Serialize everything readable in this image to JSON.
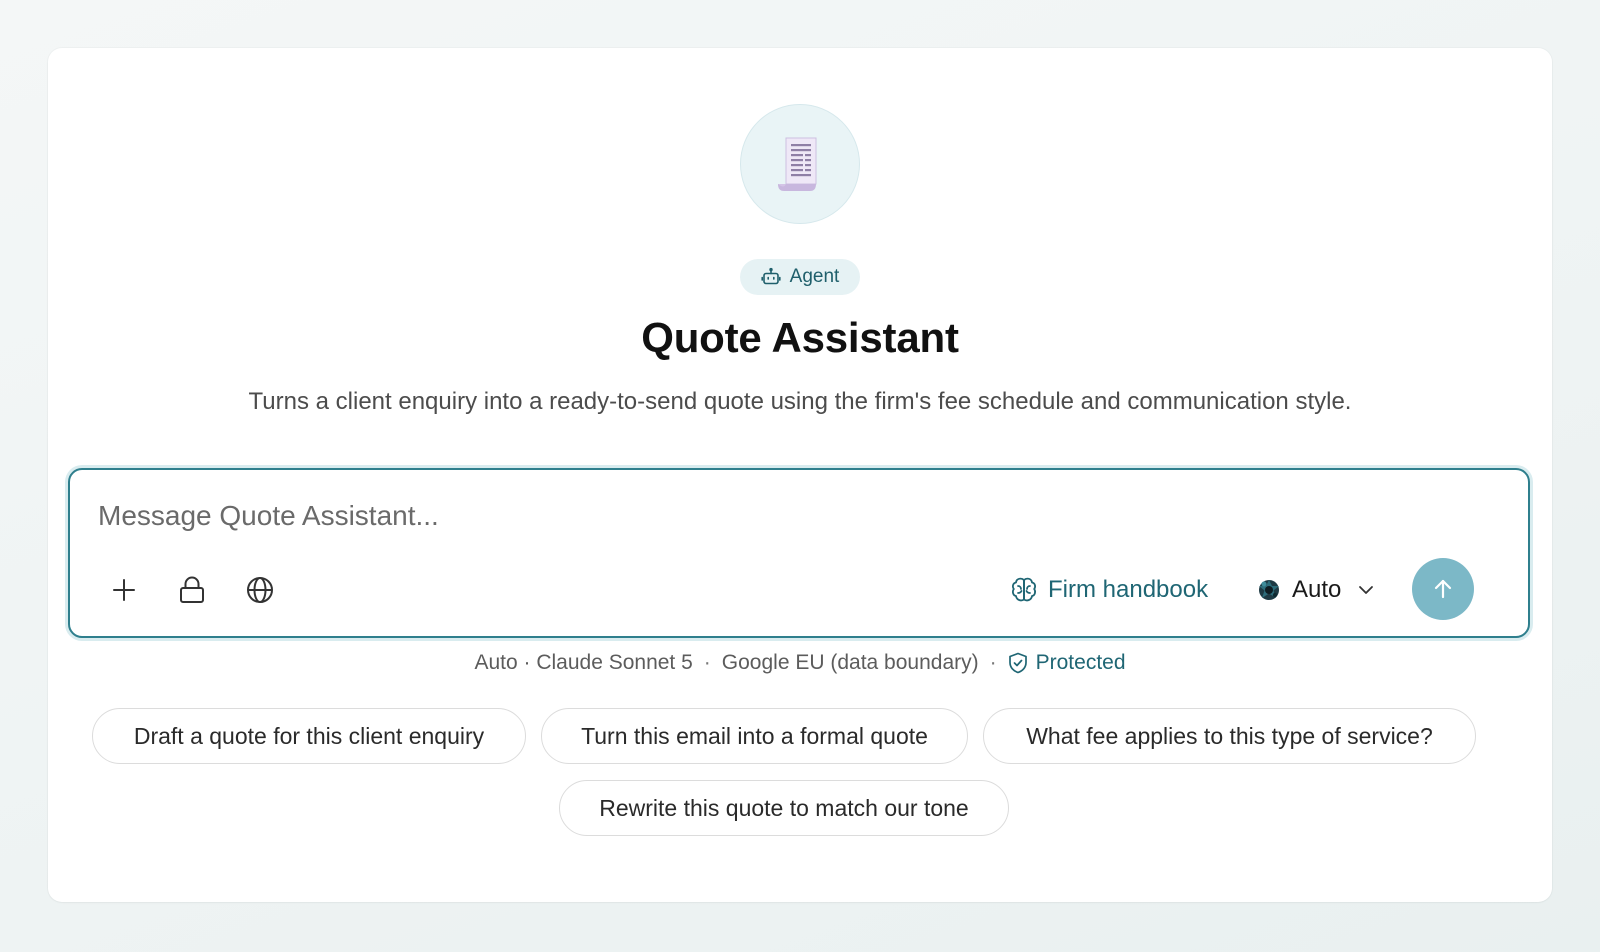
{
  "agent": {
    "icon": "receipt-icon",
    "badge_icon": "robot-icon",
    "badge_label": "Agent",
    "title": "Quote Assistant",
    "description": "Turns a client enquiry into a ready-to-send quote using the firm's fee schedule and communication style."
  },
  "composer": {
    "placeholder": "Message Quote Assistant...",
    "value": "",
    "tools": [
      {
        "icon": "plus-icon"
      },
      {
        "icon": "lock-icon"
      },
      {
        "icon": "globe-icon"
      }
    ],
    "knowledge": {
      "icon": "brain-icon",
      "label": "Firm handbook"
    },
    "model": {
      "icon": "model-logo-icon",
      "label": "Auto",
      "chevron": "chevron-down-icon"
    },
    "send": {
      "icon": "arrow-up-icon",
      "color": "#7cb8c7"
    },
    "accent_color": "#2f7f8d"
  },
  "status": {
    "model": "Auto · Claude Sonnet 5",
    "separator": "·",
    "region": "Google EU (data boundary)",
    "protected_icon": "shield-check-icon",
    "protected": "Protected"
  },
  "suggestions": [
    "Draft a quote for this client enquiry",
    "Turn this email into a formal quote",
    "What fee applies to this type of service?",
    "Rewrite this quote to match our tone"
  ]
}
